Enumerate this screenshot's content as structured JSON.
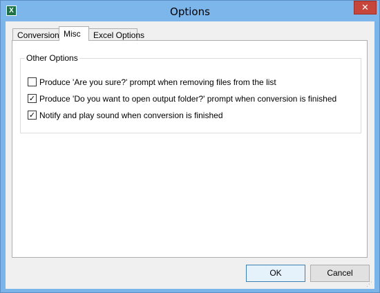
{
  "window": {
    "title": "Options",
    "app_icon_glyph": "X",
    "close_glyph": "✕"
  },
  "tabs": [
    {
      "label": "Conversions",
      "selected": false
    },
    {
      "label": "Misc",
      "selected": true
    },
    {
      "label": "Excel Options",
      "selected": false
    }
  ],
  "group": {
    "label": "Other Options"
  },
  "checkboxes": [
    {
      "label": "Produce 'Are you sure?' prompt when removing files from the list",
      "checked": false,
      "glyph": ""
    },
    {
      "label": "Produce 'Do you want to open output folder?' prompt when conversion is finished",
      "checked": true,
      "glyph": "✓"
    },
    {
      "label": "Notify and play sound when conversion is finished",
      "checked": true,
      "glyph": "✓"
    }
  ],
  "buttons": {
    "ok": "OK",
    "cancel": "Cancel"
  },
  "colors": {
    "titlebar": "#7cb6ea",
    "close_button": "#c7463b",
    "excel_icon": "#1e7145"
  }
}
